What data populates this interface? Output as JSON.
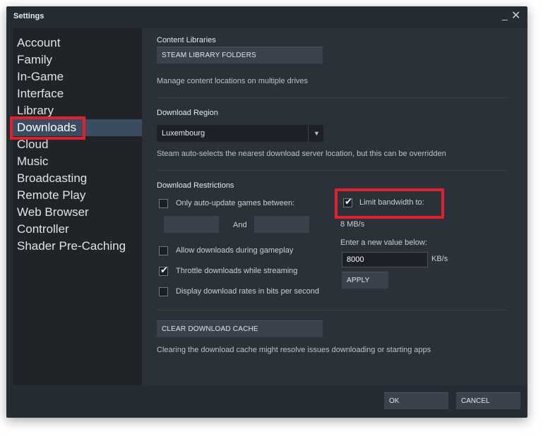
{
  "window": {
    "title": "Settings",
    "minimize_glyph": "_",
    "close_glyph": "✕"
  },
  "sidebar": {
    "items": [
      {
        "label": "Account"
      },
      {
        "label": "Family"
      },
      {
        "label": "In-Game"
      },
      {
        "label": "Interface"
      },
      {
        "label": "Library"
      },
      {
        "label": "Downloads",
        "selected": true
      },
      {
        "label": "Cloud"
      },
      {
        "label": "Music"
      },
      {
        "label": "Broadcasting"
      },
      {
        "label": "Remote Play"
      },
      {
        "label": "Web Browser"
      },
      {
        "label": "Controller"
      },
      {
        "label": "Shader Pre-Caching"
      }
    ]
  },
  "content_libraries": {
    "heading": "Content Libraries",
    "button": "STEAM LIBRARY FOLDERS",
    "description": "Manage content locations on multiple drives"
  },
  "download_region": {
    "heading": "Download Region",
    "selected": "Luxembourg",
    "description": "Steam auto-selects the nearest download server location, but this can be overridden"
  },
  "download_restrictions": {
    "heading": "Download Restrictions",
    "auto_update": {
      "label": "Only auto-update games between:",
      "checked": false,
      "and_label": "And"
    },
    "limit_bandwidth": {
      "label": "Limit bandwidth to:",
      "checked": true,
      "current": "8 MB/s"
    },
    "new_value_label": "Enter a new value below:",
    "bandwidth_value": "8000",
    "unit": "KB/s",
    "apply_button": "APPLY",
    "allow_gameplay": {
      "label": "Allow downloads during gameplay",
      "checked": false
    },
    "throttle": {
      "label": "Throttle downloads while streaming",
      "checked": true
    },
    "bits_per_second": {
      "label": "Display download rates in bits per second",
      "checked": false
    }
  },
  "cache": {
    "button": "CLEAR DOWNLOAD CACHE",
    "description": "Clearing the download cache might resolve issues downloading or starting apps"
  },
  "footer": {
    "ok": "OK",
    "cancel": "CANCEL"
  },
  "colors": {
    "highlight": "#e0202f",
    "selected_nav": "#3b4c61"
  },
  "icons": {
    "checkmark": "✔",
    "dropdown": "▼"
  }
}
